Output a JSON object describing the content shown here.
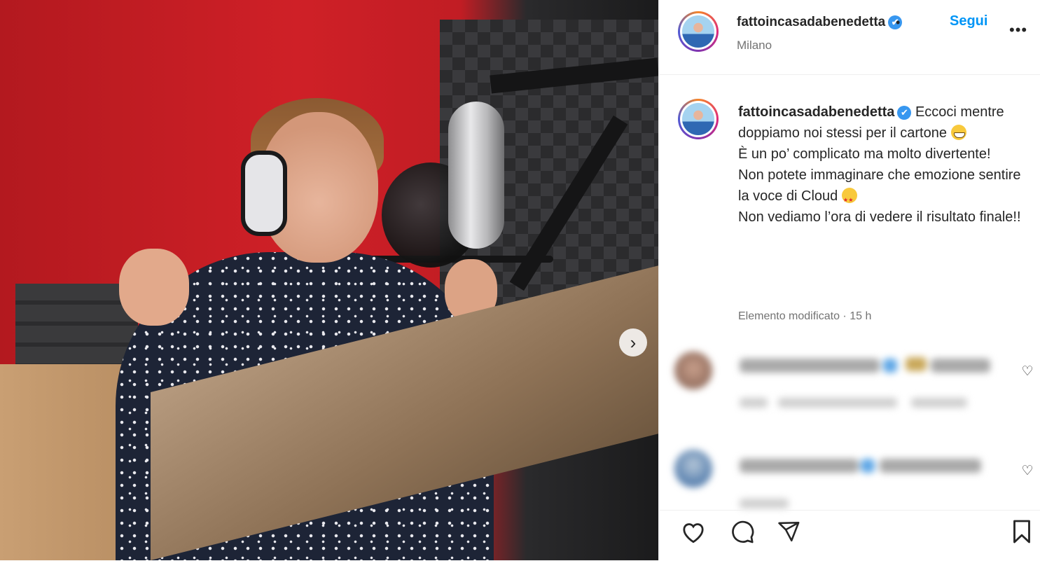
{
  "post": {
    "username": "fattoincasadabenedetta",
    "verified_mark": "✔",
    "follow_label": "Segui",
    "separator": "•",
    "location": "Milano",
    "more_label": "•••"
  },
  "caption": {
    "username": "fattoincasadabenedetta",
    "line1": "Eccoci mentre doppiamo noi stessi per il cartone",
    "line2": "È un po’ complicato ma molto divertente!",
    "line3_a": "Non potete immaginare che emozione sentire la voce di Cloud",
    "line4": "Non vediamo l’ora di vedere il risultato finale!!",
    "emoji1": "grinning-face-icon",
    "emoji2": "star-struck-icon",
    "edited_label": "Elemento modificato",
    "time_sep": "·",
    "time": "15 h"
  },
  "media": {
    "next_label": "›"
  },
  "icons": {
    "like": "heart-outline-icon",
    "comment": "comment-bubble-icon",
    "share": "paper-plane-icon",
    "save": "bookmark-icon"
  },
  "colors": {
    "accent": "#0095f6",
    "verified": "#3797f0",
    "secondary_text": "#737373"
  }
}
